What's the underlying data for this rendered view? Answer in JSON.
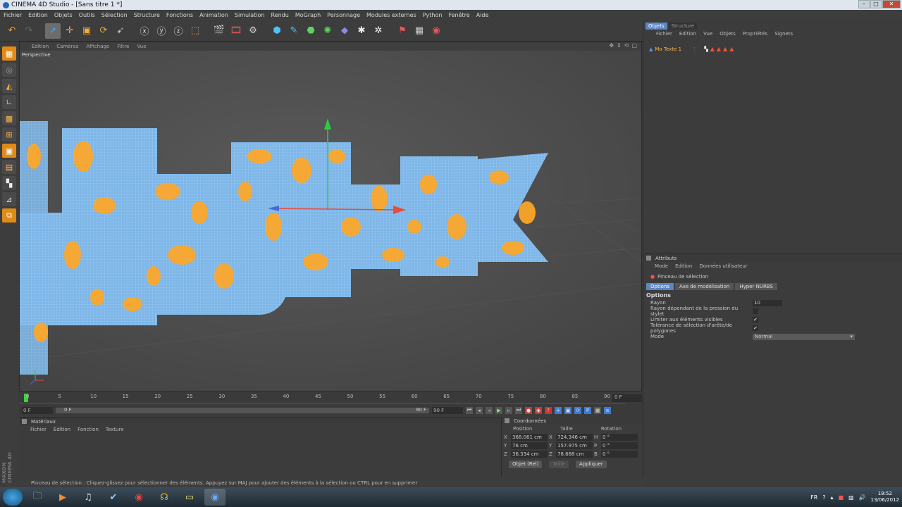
{
  "window": {
    "title": "CINEMA 4D Studio - [Sans titre 1 *]",
    "btn_min": "–",
    "btn_max": "□",
    "btn_close": "✕"
  },
  "menu": [
    "Fichier",
    "Edition",
    "Objets",
    "Outils",
    "Sélection",
    "Structure",
    "Fonctions",
    "Animation",
    "Simulation",
    "Rendu",
    "MoGraph",
    "Personnage",
    "Modules externes",
    "Python",
    "Fenêtre",
    "Aide"
  ],
  "viewport": {
    "menu": [
      "Edition",
      "Caméras",
      "Affichage",
      "Filtre",
      "Vue"
    ],
    "label": "Perspective",
    "controls": [
      "✥",
      "⇕",
      "⟲",
      "▢"
    ]
  },
  "timeline": {
    "ticks": [
      "0",
      "5",
      "10",
      "15",
      "20",
      "25",
      "30",
      "35",
      "40",
      "45",
      "50",
      "55",
      "60",
      "65",
      "70",
      "75",
      "80",
      "85",
      "90"
    ],
    "current": "0 F",
    "start": "0 F",
    "end_field": "90 F",
    "slider_start": "0 F",
    "slider_end": "90 F"
  },
  "materials": {
    "title": "Matériaux",
    "menu": [
      "Fichier",
      "Edition",
      "Fonction",
      "Texture"
    ]
  },
  "coordinates": {
    "title": "Coordonnées",
    "headers": [
      "Position",
      "Taille",
      "Rotation"
    ],
    "rows": [
      {
        "ax": "X",
        "pos": "368.061 cm",
        "sax": "X",
        "size": "724.346 cm",
        "rax": "H",
        "rot": "0 °"
      },
      {
        "ax": "Y",
        "pos": "76 cm",
        "sax": "Y",
        "size": "157.975 cm",
        "rax": "P",
        "rot": "0 °"
      },
      {
        "ax": "Z",
        "pos": "36.334 cm",
        "sax": "Z",
        "size": "78.668 cm",
        "rax": "B",
        "rot": "0 °"
      }
    ],
    "mode": "Objet (Rel)",
    "size_mode": "Taille",
    "apply": "Appliquer"
  },
  "objects": {
    "tabs": [
      "Objets",
      "Structure"
    ],
    "menu": [
      "Fichier",
      "Edition",
      "Vue",
      "Objets",
      "Propriétés",
      "Signets"
    ],
    "item": "Mo Texte 1"
  },
  "attributes": {
    "title": "Attributs",
    "menu": [
      "Mode",
      "Edition",
      "Données utilisateur"
    ],
    "tool": "Pinceau de sélection",
    "tabs": [
      "Options",
      "Axe de modélisation",
      "Hyper NURBS"
    ],
    "section": "Options",
    "rows": [
      {
        "label": "Rayon",
        "value": "10"
      },
      {
        "label": "Rayon dépendant de la pression du stylet",
        "value": ""
      },
      {
        "label": "Limiter aux éléments visibles",
        "value": "✔"
      },
      {
        "label": "Tolérance de sélection d'arête/de polygones",
        "value": "✔"
      },
      {
        "label": "Mode",
        "value": "Normal"
      }
    ]
  },
  "status": "Pinceau de sélection : Cliquez-glissez pour sélectionner des éléments. Appuyez sur MAJ pour ajouter des éléments à la sélection ou CTRL pour en supprimer",
  "brand": "MAXON CINEMA 4D",
  "taskbar": {
    "lang": "FR",
    "time": "19:52",
    "date": "13/06/2012"
  },
  "colors": {
    "accent": "#5b86c2",
    "orange": "#ffa726",
    "blue": "#7ab3e6"
  }
}
